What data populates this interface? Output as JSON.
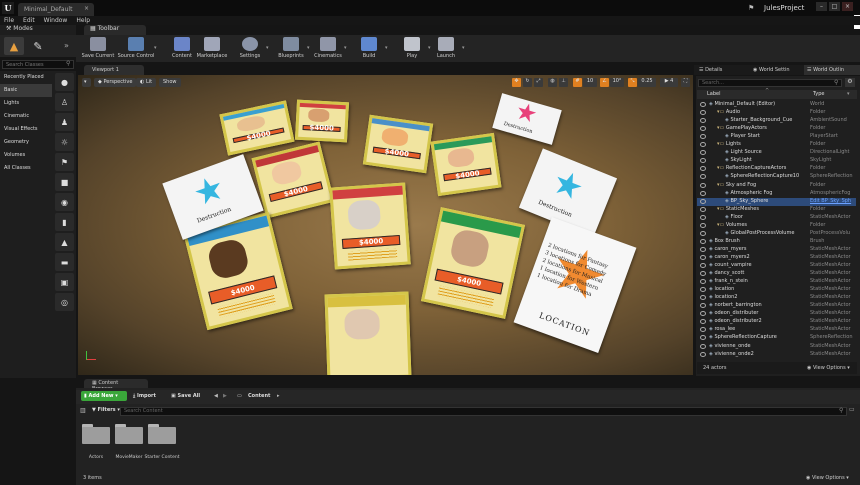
{
  "window": {
    "doc_tab": "Minimal_Default",
    "project": "JulesProject",
    "min": "–",
    "max": "□",
    "close": "×"
  },
  "menu": [
    "File",
    "Edit",
    "Window",
    "Help"
  ],
  "tabs": {
    "modes": "Modes",
    "toolbar": "Toolbar",
    "viewport": "Viewport 1",
    "details": "Details",
    "world_settings": "World Settin",
    "world_outliner": "World Outlin",
    "content_browser": "Content Browser"
  },
  "toolbar": {
    "buttons": [
      {
        "label": "Save Current",
        "icon": "save-icon"
      },
      {
        "label": "Source Control",
        "icon": "source-control-icon"
      },
      {
        "label": "Content",
        "icon": "content-icon"
      },
      {
        "label": "Marketplace",
        "icon": "marketplace-icon"
      },
      {
        "label": "Settings",
        "icon": "settings-icon"
      },
      {
        "label": "Blueprints",
        "icon": "blueprints-icon"
      },
      {
        "label": "Cinematics",
        "icon": "cinematics-icon"
      },
      {
        "label": "Build",
        "icon": "build-icon"
      },
      {
        "label": "Play",
        "icon": "play-icon"
      },
      {
        "label": "Launch",
        "icon": "launch-icon"
      }
    ]
  },
  "modes": {
    "search_placeholder": "Search Classes",
    "categories": [
      "Recently Placed",
      "Basic",
      "Lights",
      "Cinematic",
      "Visual Effects",
      "Geometry",
      "Volumes",
      "All Classes"
    ],
    "active_category": "Basic"
  },
  "viewport": {
    "perspective": "Perspective",
    "lit": "Lit",
    "show": "Show",
    "grid_snap": "10",
    "rot_snap": "10°",
    "scale_snap": "0.25",
    "cam_speed": "4"
  },
  "cards": {
    "price": "$4000",
    "star_text": "Destruction",
    "location_title": "LOCATION",
    "location_lines": [
      "2 locations for Fantasy",
      "3 locations for Comedy",
      "2 locations for Musical",
      "1 location for Western",
      "1 location for Drama"
    ]
  },
  "outliner": {
    "search_placeholder": "Search...",
    "col_label": "Label",
    "col_type": "Type",
    "rows": [
      {
        "label": "Minimal_Default (Editor)",
        "type": "World",
        "indent": 0
      },
      {
        "label": "Audio",
        "type": "Folder",
        "indent": 1
      },
      {
        "label": "Starter_Background_Cue",
        "type": "AmbientSound",
        "indent": 2
      },
      {
        "label": "GamePlayActors",
        "type": "Folder",
        "indent": 1
      },
      {
        "label": "Player Start",
        "type": "PlayerStart",
        "indent": 2
      },
      {
        "label": "Lights",
        "type": "Folder",
        "indent": 1
      },
      {
        "label": "Light Source",
        "type": "DirectionalLight",
        "indent": 2
      },
      {
        "label": "SkyLight",
        "type": "SkyLight",
        "indent": 2
      },
      {
        "label": "ReflectionCaptureActors",
        "type": "Folder",
        "indent": 1
      },
      {
        "label": "SphereReflectionCapture10",
        "type": "SphereReflection",
        "indent": 2
      },
      {
        "label": "Sky and Fog",
        "type": "Folder",
        "indent": 1
      },
      {
        "label": "Atmospheric Fog",
        "type": "AtmosphericFog",
        "indent": 2
      },
      {
        "label": "BP_Sky_Sphere",
        "type": "Edit BP_Sky_Sph",
        "indent": 2,
        "link": true
      },
      {
        "label": "StaticMeshes",
        "type": "Folder",
        "indent": 1
      },
      {
        "label": "Floor",
        "type": "StaticMeshActor",
        "indent": 2
      },
      {
        "label": "Volumes",
        "type": "Folder",
        "indent": 1
      },
      {
        "label": "GlobalPostProcessVolume",
        "type": "PostProcessVolu",
        "indent": 2
      },
      {
        "label": "Box Brush",
        "type": "Brush",
        "indent": 0
      },
      {
        "label": "caron_myers",
        "type": "StaticMeshActor",
        "indent": 0
      },
      {
        "label": "caron_myers2",
        "type": "StaticMeshActor",
        "indent": 0
      },
      {
        "label": "count_vampire",
        "type": "StaticMeshActor",
        "indent": 0
      },
      {
        "label": "dancy_scott",
        "type": "StaticMeshActor",
        "indent": 0
      },
      {
        "label": "frank_n_stein",
        "type": "StaticMeshActor",
        "indent": 0
      },
      {
        "label": "location",
        "type": "StaticMeshActor",
        "indent": 0
      },
      {
        "label": "location2",
        "type": "StaticMeshActor",
        "indent": 0
      },
      {
        "label": "norbert_barrington",
        "type": "StaticMeshActor",
        "indent": 0
      },
      {
        "label": "odeon_distributer",
        "type": "StaticMeshActor",
        "indent": 0
      },
      {
        "label": "odeon_distributer2",
        "type": "StaticMeshActor",
        "indent": 0
      },
      {
        "label": "rosa_lee",
        "type": "StaticMeshActor",
        "indent": 0
      },
      {
        "label": "SphereReflectionCapture",
        "type": "SphereReflection",
        "indent": 0
      },
      {
        "label": "vivienne_onde",
        "type": "StaticMeshActor",
        "indent": 0
      },
      {
        "label": "vivienne_onde2",
        "type": "StaticMeshActor",
        "indent": 0
      }
    ],
    "actor_count": "24 actors",
    "view_options": "View Options"
  },
  "content_browser": {
    "add_new": "Add New",
    "import": "Import",
    "save_all": "Save All",
    "path": "Content",
    "filters": "Filters",
    "search_placeholder": "Search Content",
    "folders": [
      "Actors",
      "MovieMaker",
      "Starter Content"
    ],
    "item_count": "3 items",
    "view_options": "View Options"
  }
}
